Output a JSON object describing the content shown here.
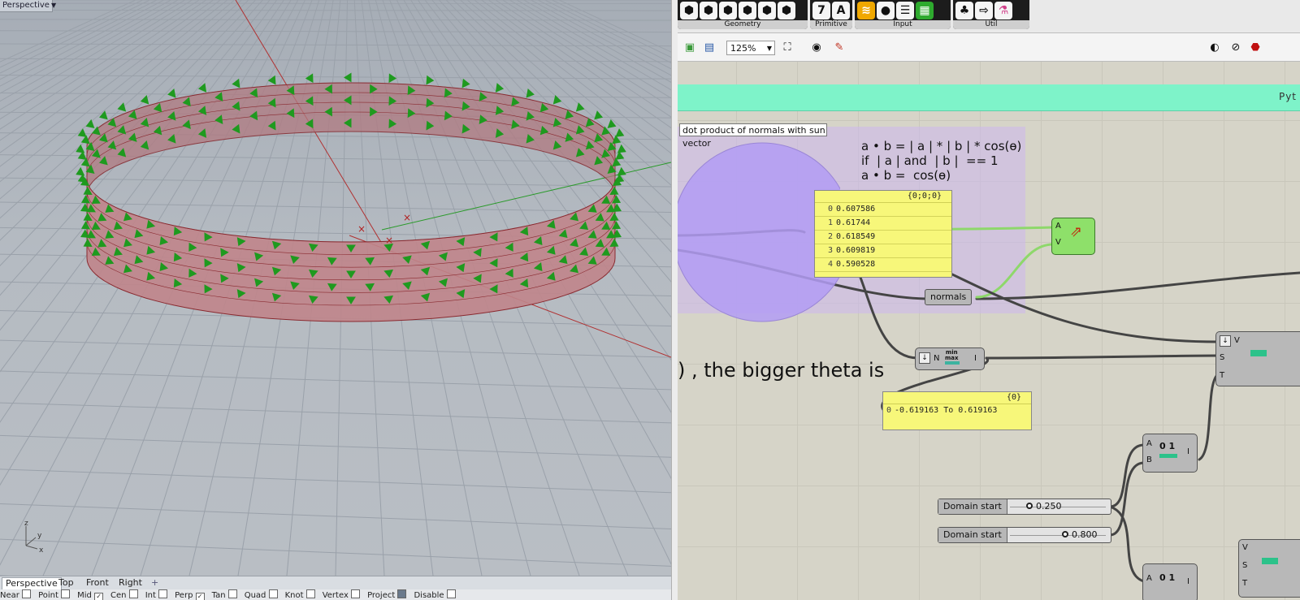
{
  "viewport": {
    "title": "Perspective",
    "tabs": [
      "Perspective",
      "Top",
      "Front",
      "Right"
    ],
    "add_tab": "+",
    "axes": {
      "z": "z",
      "y": "y",
      "x": "x"
    },
    "snaps": [
      {
        "label": "Near",
        "checked": false
      },
      {
        "label": "Point",
        "checked": false
      },
      {
        "label": "Mid",
        "checked": true
      },
      {
        "label": "Cen",
        "checked": false
      },
      {
        "label": "Int",
        "checked": false
      },
      {
        "label": "Perp",
        "checked": true
      },
      {
        "label": "Tan",
        "checked": false
      },
      {
        "label": "Quad",
        "checked": false
      },
      {
        "label": "Knot",
        "checked": false
      },
      {
        "label": "Vertex",
        "checked": false
      },
      {
        "label": "Project",
        "checked": true
      },
      {
        "label": "Disable",
        "checked": false
      }
    ]
  },
  "ribbon": {
    "groups": [
      {
        "label": "Geometry",
        "icons": [
          "hexagon-icon",
          "hexagon-icon",
          "hexagon-icon",
          "hexagon-icon",
          "hexagon-icon",
          "hexagon-icon"
        ]
      },
      {
        "label": "Primitive",
        "icons": [
          "seven-icon",
          "a-icon"
        ]
      },
      {
        "label": "Input",
        "icons": [
          "panel-icon",
          "circle-icon",
          "list-icon",
          "gradient-icon"
        ]
      },
      {
        "label": "Util",
        "icons": [
          "tree-icon",
          "arrow-icon",
          "flask-icon"
        ]
      }
    ],
    "expand": "+"
  },
  "toolbar": {
    "zoom": "125%"
  },
  "canvas": {
    "group_label": "Pyt",
    "balloon": "dot product of normals with sun vector",
    "formula": [
      "a • b = | a | * | b | * cos(ɵ)",
      "if  | a | and  | b |  == 1",
      "a • b =  cos(ɵ)"
    ],
    "big_text": ") , the bigger theta is",
    "panel1": {
      "header": "{0;0;0}",
      "rows": [
        {
          "index": "0",
          "value": "0.607586"
        },
        {
          "index": "1",
          "value": "0.61744"
        },
        {
          "index": "2",
          "value": "0.618549"
        },
        {
          "index": "3",
          "value": "0.609819"
        },
        {
          "index": "4",
          "value": "0.590528"
        }
      ]
    },
    "panel2": {
      "header": "{0}",
      "rows": [
        {
          "index": "0",
          "value": "-0.619163 To 0.619163"
        }
      ]
    },
    "vector_display": {
      "inputs": [
        "A",
        "V"
      ]
    },
    "normals_param": "normals",
    "bounds": {
      "inputs": [
        "N"
      ],
      "outputs": [
        "I"
      ],
      "icon_label": "min\nmax"
    },
    "remap": {
      "inputs": [
        "V",
        "S",
        "T"
      ]
    },
    "construct1": {
      "inputs": [
        "A",
        "B"
      ],
      "outputs": [
        "I"
      ],
      "icon_label": "0 1"
    },
    "construct2": {
      "inputs": [
        "A"
      ],
      "outputs": [
        "I"
      ],
      "icon_label": "0 1"
    },
    "remap2": {
      "inputs": [
        "V",
        "S",
        "T"
      ]
    },
    "sliders": [
      {
        "label": "Domain start",
        "value": "0.250",
        "fraction": 0.25
      },
      {
        "label": "Domain start",
        "value": "0.800",
        "fraction": 0.8
      }
    ]
  }
}
